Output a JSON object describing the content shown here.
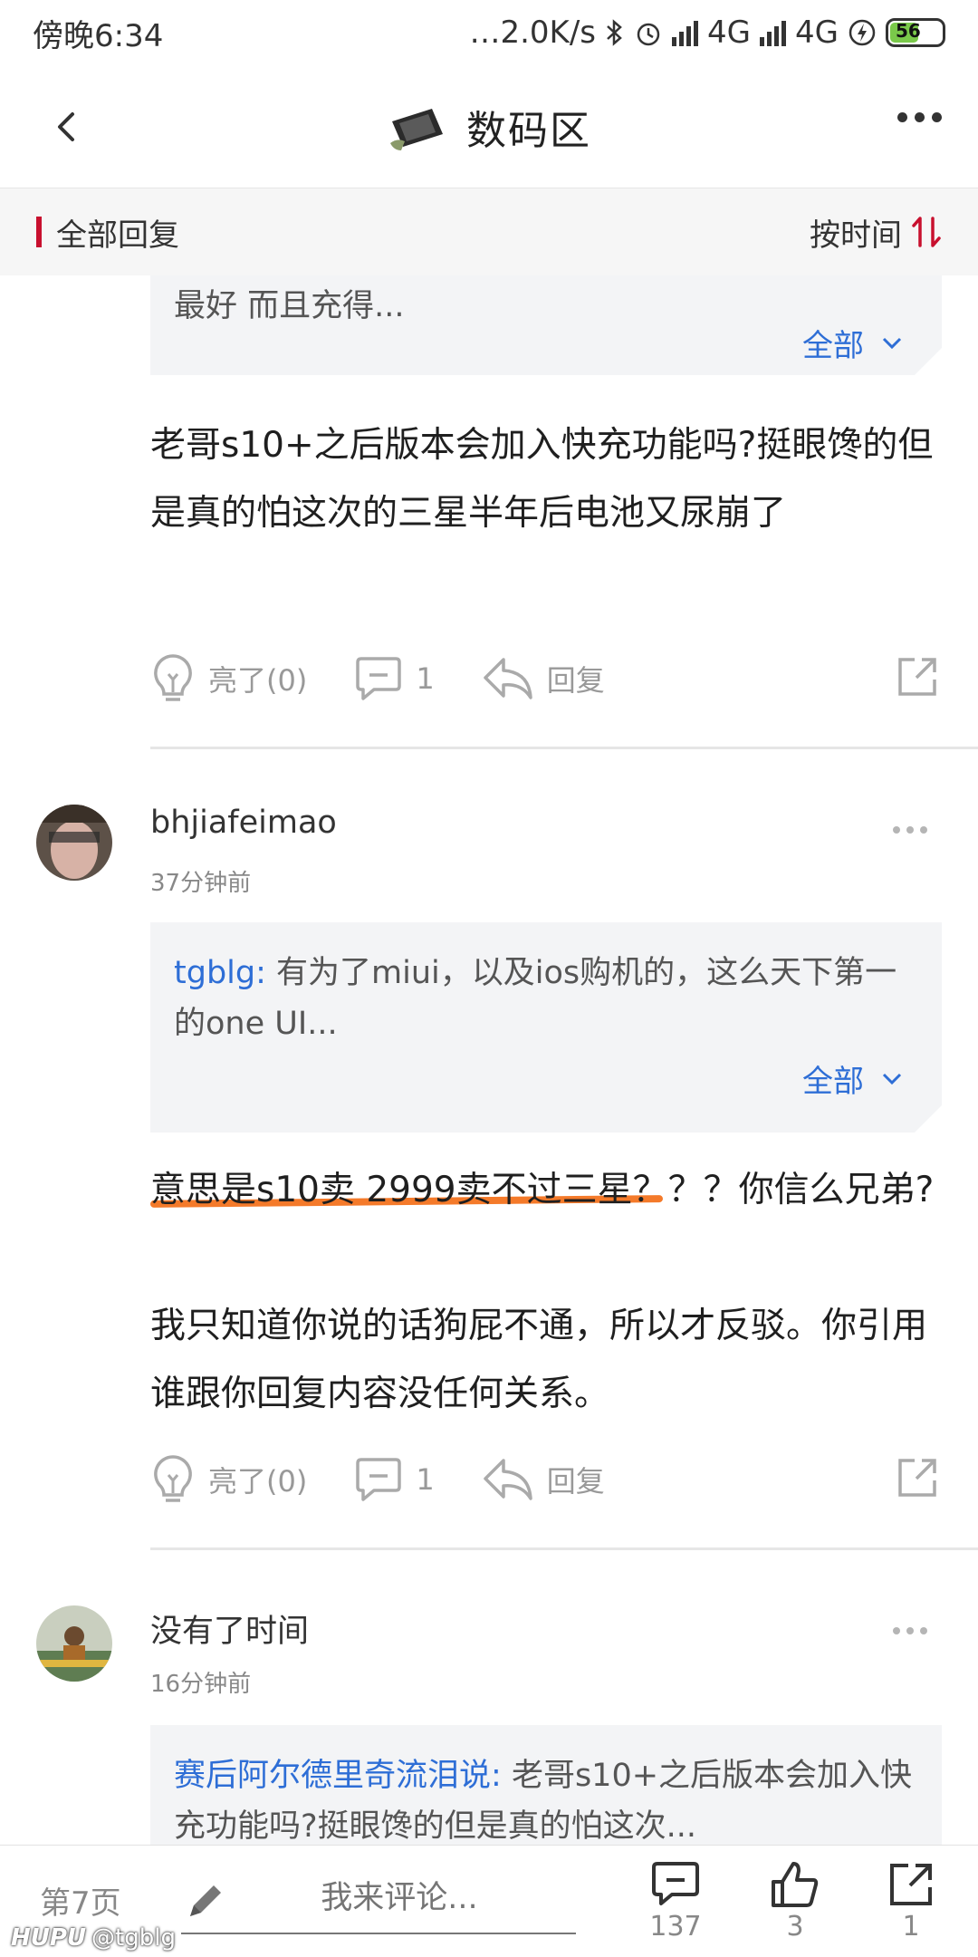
{
  "status_bar": {
    "time": "傍晚6:34",
    "network_speed": "…2.0K/s",
    "network1": "4G",
    "network2": "4G",
    "battery": "56"
  },
  "header": {
    "title": "数码区"
  },
  "filter": {
    "label": "全部回复",
    "sort_label": "按时间"
  },
  "posts": [
    {
      "quote": {
        "author": "",
        "text": "最好 而且充得...",
        "expand_label": "全部"
      },
      "reply": "老哥s10+之后版本会加入快充功能吗?挺眼馋的但是真的怕这次的三星半年后电池又尿崩了",
      "actions": {
        "like": "亮了(0)",
        "comments": "1",
        "reply": "回复"
      }
    },
    {
      "username": "bhjiafeimao",
      "time": "37分钟前",
      "quote": {
        "author": "tgblg:",
        "text": "有为了miui，以及ios购机的，这么天下第一的one UI...",
        "expand_label": "全部"
      },
      "reply_line1": "意思是s10卖 2999卖不过三星？？？你信么兄弟?",
      "reply_line2": "我只知道你说的话狗屁不通，所以才反驳。你引用谁跟你回复内容没任何关系。",
      "actions": {
        "like": "亮了(0)",
        "comments": "1",
        "reply": "回复"
      }
    },
    {
      "username": "没有了时间",
      "time": "16分钟前",
      "quote": {
        "author": "赛后阿尔德里奇流泪说:",
        "text": "老哥s10+之后版本会加入快充功能吗?挺眼馋的但是真的怕这次..."
      }
    }
  ],
  "bottom_bar": {
    "page": "第7页",
    "comment_placeholder": "我来评论...",
    "comment_count": "137",
    "like_count": "3",
    "share_count": "1"
  },
  "watermark": {
    "brand": "HUPU",
    "handle": "@tgblg"
  },
  "colors": {
    "accent_red": "#c8102e",
    "link_blue": "#2e6ed6",
    "highlight_orange": "#f47a2a"
  }
}
